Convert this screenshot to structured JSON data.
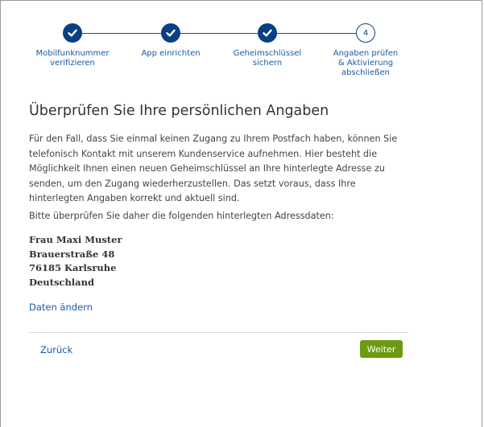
{
  "stepper": {
    "steps": [
      {
        "label": "Mobilfunknummer\nverifizieren",
        "status": "done",
        "icon": "checkmark-icon"
      },
      {
        "label": "App einrichten",
        "status": "done",
        "icon": "checkmark-icon"
      },
      {
        "label": "Geheimschlüssel\nsichern",
        "status": "done",
        "icon": "checkmark-icon"
      },
      {
        "label": "Angaben prüfen\n& Aktivierung\nabschließen",
        "status": "current",
        "number": "4"
      }
    ]
  },
  "main": {
    "title": "Überprüfen Sie Ihre persönlichen Angaben",
    "intro": "Für den Fall, dass Sie einmal keinen Zugang zu Ihrem Postfach haben, können Sie telefonisch Kontakt mit unserem Kundenservice aufnehmen. Hier besteht die Möglichkeit Ihnen einen neuen Geheimschlüssel an Ihre hinterlegte Adresse zu senden, um den Zugang wiederherzustellen. Das setzt voraus, dass Ihre hinterlegten Angaben korrekt und aktuell sind.",
    "prompt": "Bitte überprüfen Sie daher die folgenden hinterlegten Adressdaten:",
    "address": {
      "name": "Frau Maxi Muster",
      "street": "Brauerstraße 48",
      "city": "76185 Karlsruhe",
      "country": "Deutschland"
    },
    "edit_link": "Daten ändern"
  },
  "footer": {
    "back_label": "Zurück",
    "next_label": "Weiter"
  },
  "colors": {
    "accent": "#0b3f83",
    "link": "#1a5aa6",
    "primary_button": "#6b9a10"
  }
}
